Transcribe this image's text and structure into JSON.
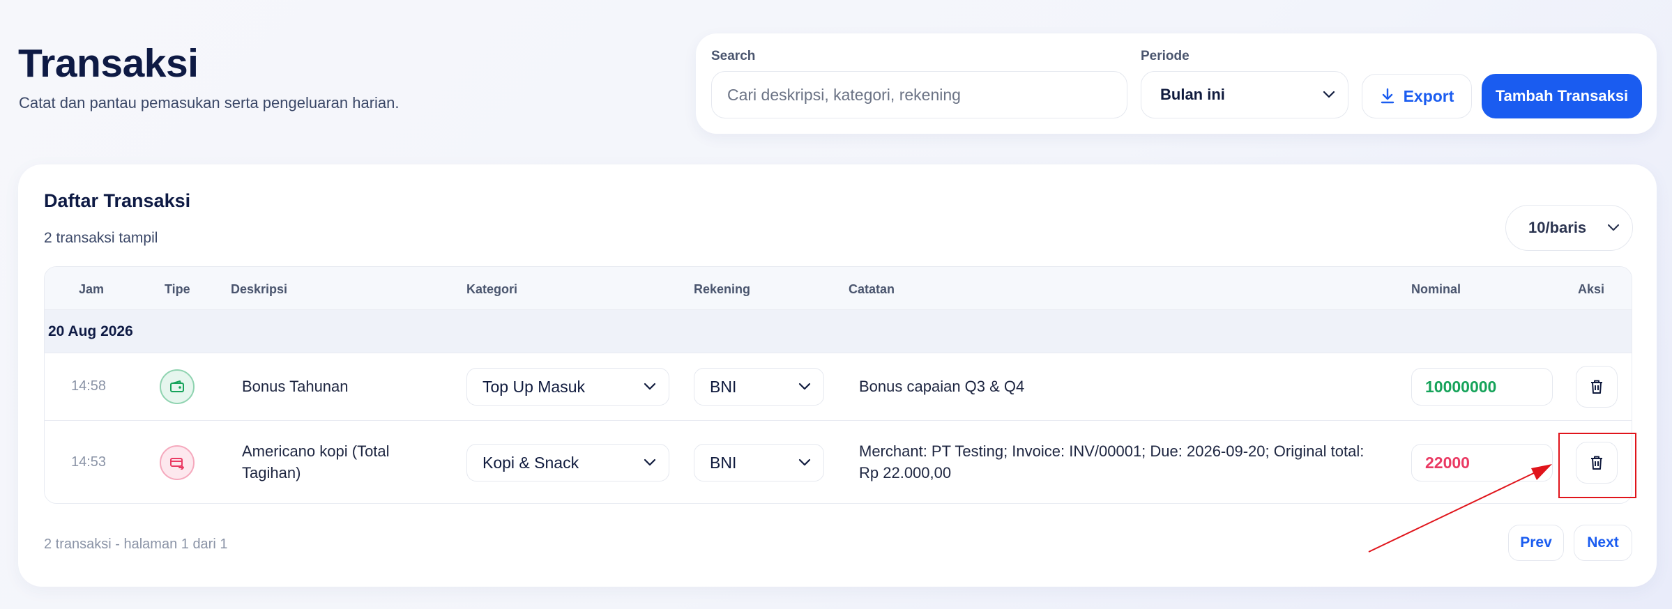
{
  "header": {
    "title": "Transaksi",
    "subtitle": "Catat dan pantau pemasukan serta pengeluaran harian."
  },
  "toolbar": {
    "search_label": "Search",
    "search_placeholder": "Cari deskripsi, kategori, rekening",
    "period_label": "Periode",
    "period_value": "Bulan ini",
    "export_label": "Export",
    "add_label": "Tambah Transaksi"
  },
  "list": {
    "title": "Daftar Transaksi",
    "count_text": "2 transaksi tampil",
    "rows_per_page": "10/baris",
    "columns": [
      "Jam",
      "Tipe",
      "Deskripsi",
      "Kategori",
      "Rekening",
      "Catatan",
      "Nominal",
      "Aksi"
    ],
    "group_date": "20 Aug 2026",
    "rows": [
      {
        "time": "14:58",
        "type": "income",
        "type_icon": "wallet-in-icon",
        "description": "Bonus Tahunan",
        "category": "Top Up Masuk",
        "account": "BNI",
        "note": "Bonus capaian Q3 & Q4",
        "amount": "10000000"
      },
      {
        "time": "14:53",
        "type": "expense",
        "type_icon": "card-out-icon",
        "description": "Americano kopi (Total Tagihan)",
        "category": "Kopi & Snack",
        "account": "BNI",
        "note": "Merchant: PT Testing; Invoice: INV/00001; Due: 2026-09-20; Original total: Rp 22.000,00",
        "amount": "22000"
      }
    ],
    "footer_text": "2 transaksi - halaman 1 dari 1",
    "prev_label": "Prev",
    "next_label": "Next"
  },
  "colors": {
    "accent": "#1a5cf0",
    "income": "#16a35a",
    "expense": "#ea3a63",
    "annotation": "#e0141b"
  }
}
